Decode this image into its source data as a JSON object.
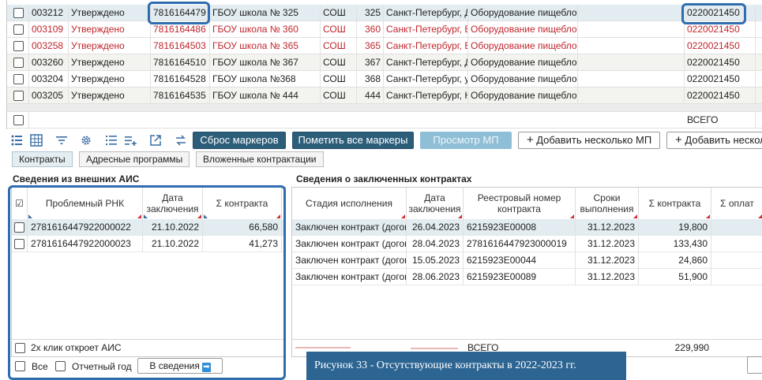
{
  "top_grid": {
    "rows": [
      {
        "id": "003212",
        "status": "Утверждено",
        "inn": "7816164479",
        "name": "ГБОУ школа № 325",
        "type": "СОШ",
        "num": "325",
        "addr": "Санкт-Петербург, Д",
        "equip": "Оборудование пищебло",
        "code": "0220021450",
        "style": "sel"
      },
      {
        "id": "003109",
        "status": "Утверждено",
        "inn": "7816164486",
        "name": "ГБОУ школа № 360",
        "type": "СОШ",
        "num": "360",
        "addr": "Санкт-Петербург, Е",
        "equip": "Оборудование пищебло",
        "code": "0220021450",
        "style": "red"
      },
      {
        "id": "003258",
        "status": "Утверждено",
        "inn": "7816164503",
        "name": "ГБОУ школа № 365",
        "type": "СОШ",
        "num": "365",
        "addr": "Санкт-Петербург, Е",
        "equip": "Оборудование пищебло",
        "code": "0220021450",
        "style": "red"
      },
      {
        "id": "003260",
        "status": "Утверждено",
        "inn": "7816164510",
        "name": "ГБОУ школа № 367",
        "type": "СОШ",
        "num": "367",
        "addr": "Санкт-Петербург, Д",
        "equip": "Оборудование пищебло",
        "code": "0220021450",
        "style": "alt"
      },
      {
        "id": "003204",
        "status": "Утверждено",
        "inn": "7816164528",
        "name": "ГБОУ школа №368",
        "type": "СОШ",
        "num": "368",
        "addr": "Санкт-Петербург, у",
        "equip": "Оборудование пищебло",
        "code": "0220021450",
        "style": ""
      },
      {
        "id": "003205",
        "status": "Утверждено",
        "inn": "7816164535",
        "name": "ГБОУ школа № 444",
        "type": "СОШ",
        "num": "444",
        "addr": "Санкт-Петербург, Н",
        "equip": "Оборудование пищебло",
        "code": "0220021450",
        "style": "alt"
      }
    ],
    "total_label": "ВСЕГО"
  },
  "toolbar": {
    "reset_markers": "Сброс маркеров",
    "mark_all": "Пометить все маркеры",
    "view_mp": "Просмотр МП",
    "add_several_mp": "Добавить несколько МП",
    "add_several_partial": "Добавить несколь"
  },
  "icons": {
    "plus": "+",
    "arrow": "➡"
  },
  "tabs": [
    "Контракты",
    "Адресные программы",
    "Вложенные контрактации"
  ],
  "left": {
    "title": "Сведения из внешних АИС",
    "check_all_glyph": "☑",
    "headers": {
      "rnk": "Проблемный РНК",
      "date": "Дата заключения",
      "sum": "Σ контракта"
    },
    "rows": [
      {
        "rnk": "2781616447922000022",
        "date": "21.10.2022",
        "sum": "66,580"
      },
      {
        "rnk": "2781616447922000023",
        "date": "21.10.2022",
        "sum": "41,273"
      }
    ],
    "hint": "2х клик откроет АИС",
    "all_label": "Все",
    "report_year_label": "Отчетный год",
    "to_info_button": "В сведения"
  },
  "right": {
    "title": "Сведения о заключенных контрактах",
    "headers": {
      "stage": "Стадия исполнения",
      "date": "Дата заключения",
      "reg": "Реестровый номер контракта",
      "term": "Сроки выполнения",
      "sum": "Σ контракта",
      "paid": "Σ оплат"
    },
    "rows": [
      {
        "stage": "Заключен контракт (догов",
        "date": "26.04.2023",
        "reg": "6215923E00008",
        "term": "31.12.2023",
        "sum": "19,800"
      },
      {
        "stage": "Заключен контракт (догов",
        "date": "28.04.2023",
        "reg": "2781616447923000019",
        "term": "31.12.2023",
        "sum": "133,430"
      },
      {
        "stage": "Заключен контракт (догов",
        "date": "15.05.2023",
        "reg": "6215923E00044",
        "term": "31.12.2023",
        "sum": "24,860"
      },
      {
        "stage": "Заключен контракт (догов",
        "date": "28.06.2023",
        "reg": "6215923E00089",
        "term": "31.12.2023",
        "sum": "51,900"
      }
    ],
    "total_label": "ВСЕГО",
    "total_sum": "229,990"
  },
  "caption": "Рисунок 33 - Отсутствующие контракты в 2022-2023 гг.",
  "colors": {
    "accent": "#2c5e7a",
    "highlight": "#2f6db0",
    "error_text": "#c0262c",
    "selected_row": "#e2ecf1"
  }
}
